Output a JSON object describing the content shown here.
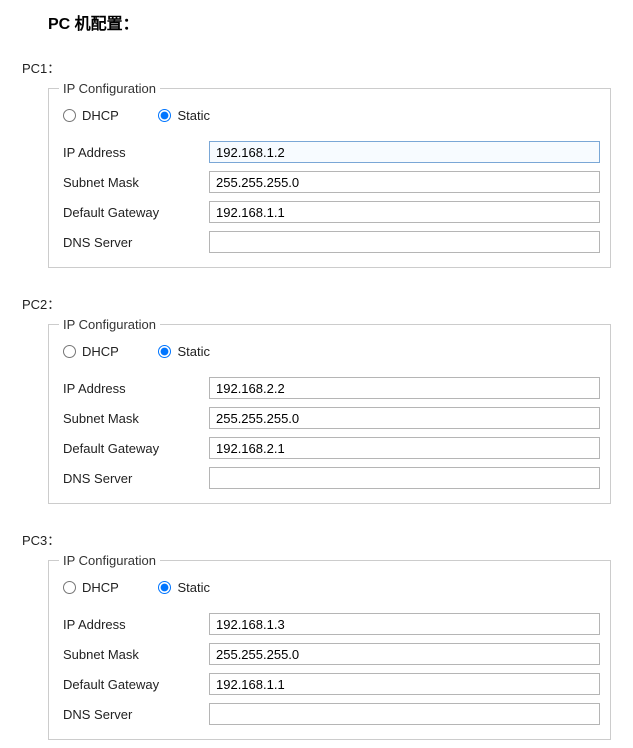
{
  "page": {
    "title": "PC 机配置："
  },
  "labels": {
    "legend": "IP Configuration",
    "dhcp": "DHCP",
    "static": "Static",
    "ip_address": "IP Address",
    "subnet_mask": "Subnet Mask",
    "default_gateway": "Default Gateway",
    "dns_server": "DNS Server"
  },
  "pcs": [
    {
      "name": "PC1：",
      "mode": "static",
      "ip": "192.168.1.2",
      "mask": "255.255.255.0",
      "gateway": "192.168.1.1",
      "dns": ""
    },
    {
      "name": "PC2：",
      "mode": "static",
      "ip": "192.168.2.2",
      "mask": "255.255.255.0",
      "gateway": "192.168.2.1",
      "dns": ""
    },
    {
      "name": "PC3：",
      "mode": "static",
      "ip": "192.168.1.3",
      "mask": "255.255.255.0",
      "gateway": "192.168.1.1",
      "dns": ""
    }
  ]
}
